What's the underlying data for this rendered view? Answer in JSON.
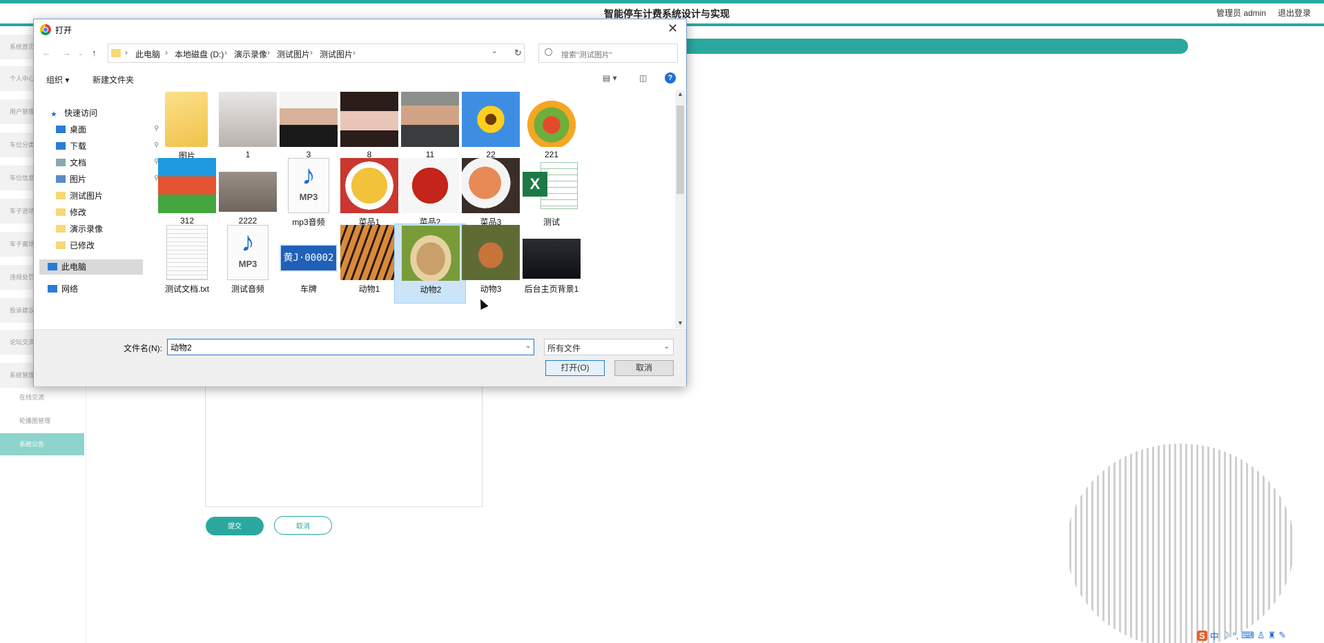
{
  "app": {
    "title": "智能停车计费系统设计与实现",
    "admin_user": "管理员 admin",
    "logout": "退出登录",
    "accent": "#2aa8a0"
  },
  "sidebar": {
    "items": [
      "系统首页",
      "个人中心",
      "用户管理",
      "车位分类",
      "车位信息",
      "车子进场",
      "车子离场",
      "违规处罚",
      "投诉建议",
      "论坛交流",
      "系统管理"
    ],
    "subitems": [
      "在线交流",
      "轮播图管理",
      "系统公告"
    ],
    "active_subitem": "系统公告"
  },
  "form": {
    "submit": "提交",
    "cancel": "取消"
  },
  "dialog": {
    "title": "打开",
    "close_icon": "close-icon",
    "breadcrumbs": [
      "此电脑",
      "本地磁盘 (D:)",
      "演示录像",
      "测试图片",
      "测试图片"
    ],
    "search_placeholder": "搜索\"测试图片\"",
    "toolbar": {
      "organize": "组织 ▾",
      "new_folder": "新建文件夹"
    },
    "tree": [
      {
        "label": "快速访问",
        "icon": "star-icon",
        "pinned": false
      },
      {
        "label": "桌面",
        "icon": "desktop-icon",
        "pinned": true
      },
      {
        "label": "下载",
        "icon": "download-icon",
        "pinned": true
      },
      {
        "label": "文档",
        "icon": "document-icon",
        "pinned": true
      },
      {
        "label": "图片",
        "icon": "pictures-icon",
        "pinned": true
      },
      {
        "label": "测试图片",
        "icon": "folder-icon",
        "pinned": false
      },
      {
        "label": "修改",
        "icon": "folder-icon",
        "pinned": false
      },
      {
        "label": "演示录像",
        "icon": "folder-icon",
        "pinned": false
      },
      {
        "label": "已修改",
        "icon": "folder-icon",
        "pinned": false
      },
      {
        "label": "此电脑",
        "icon": "computer-icon",
        "pinned": false
      },
      {
        "label": "网络",
        "icon": "network-icon",
        "pinned": false
      }
    ],
    "files": [
      {
        "name": "图片",
        "kind": "folder"
      },
      {
        "name": "1",
        "kind": "photo-woman"
      },
      {
        "name": "3",
        "kind": "photo-man"
      },
      {
        "name": "8",
        "kind": "photo-woman2"
      },
      {
        "name": "11",
        "kind": "photo-man2"
      },
      {
        "name": "22",
        "kind": "photo-sunflower"
      },
      {
        "name": "221",
        "kind": "photo-vegetables"
      },
      {
        "name": "312",
        "kind": "archive"
      },
      {
        "name": "2222",
        "kind": "photo-bottles"
      },
      {
        "name": "mp3音频",
        "kind": "mp3"
      },
      {
        "name": "菜品1",
        "kind": "photo-dish1"
      },
      {
        "name": "菜品2",
        "kind": "photo-dish2"
      },
      {
        "name": "菜品3",
        "kind": "photo-dish3"
      },
      {
        "name": "测试",
        "kind": "excel"
      },
      {
        "name": "测试文档.txt",
        "kind": "txt"
      },
      {
        "name": "测试音频",
        "kind": "mp3"
      },
      {
        "name": "车牌",
        "kind": "plate"
      },
      {
        "name": "动物1",
        "kind": "photo-tiger"
      },
      {
        "name": "动物2",
        "kind": "photo-rabbit"
      },
      {
        "name": "动物3",
        "kind": "photo-fox"
      },
      {
        "name": "后台主页背景1",
        "kind": "photo-dark"
      }
    ],
    "selected_file": "动物2",
    "mp3_label": "MP3",
    "plate_text": "黄J·00002",
    "filename_label": "文件名(N):",
    "filename_value": "动物2",
    "filetype": "所有文件",
    "open_button": "打开(O)",
    "cancel_button": "取消"
  }
}
